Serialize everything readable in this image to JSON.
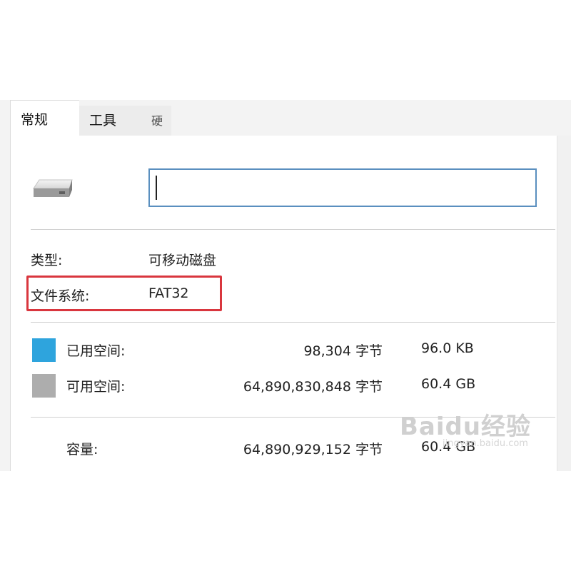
{
  "tabs": [
    {
      "label": "常规"
    },
    {
      "label": "工具"
    },
    {
      "label": "硬"
    }
  ],
  "name_input": {
    "value": "",
    "placeholder": ""
  },
  "type": {
    "label": "类型:",
    "value": "可移动磁盘"
  },
  "filesystem": {
    "label": "文件系统:",
    "value": "FAT32"
  },
  "used": {
    "label": "已用空间:",
    "bytes": "98,304 字节",
    "size": "96.0 KB",
    "color": "#2ea4dd"
  },
  "free": {
    "label": "可用空间:",
    "bytes": "64,890,830,848 字节",
    "size": "60.4 GB",
    "color": "#adadad"
  },
  "capacity": {
    "label": "容量:",
    "bytes": "64,890,929,152 字节",
    "size": "60.4 GB"
  },
  "icons": {
    "drive": "removable-drive-icon"
  },
  "highlight_color": "#d9363e",
  "watermark": {
    "main": "Baidu经验",
    "sub": "jingyan.baidu.com"
  }
}
